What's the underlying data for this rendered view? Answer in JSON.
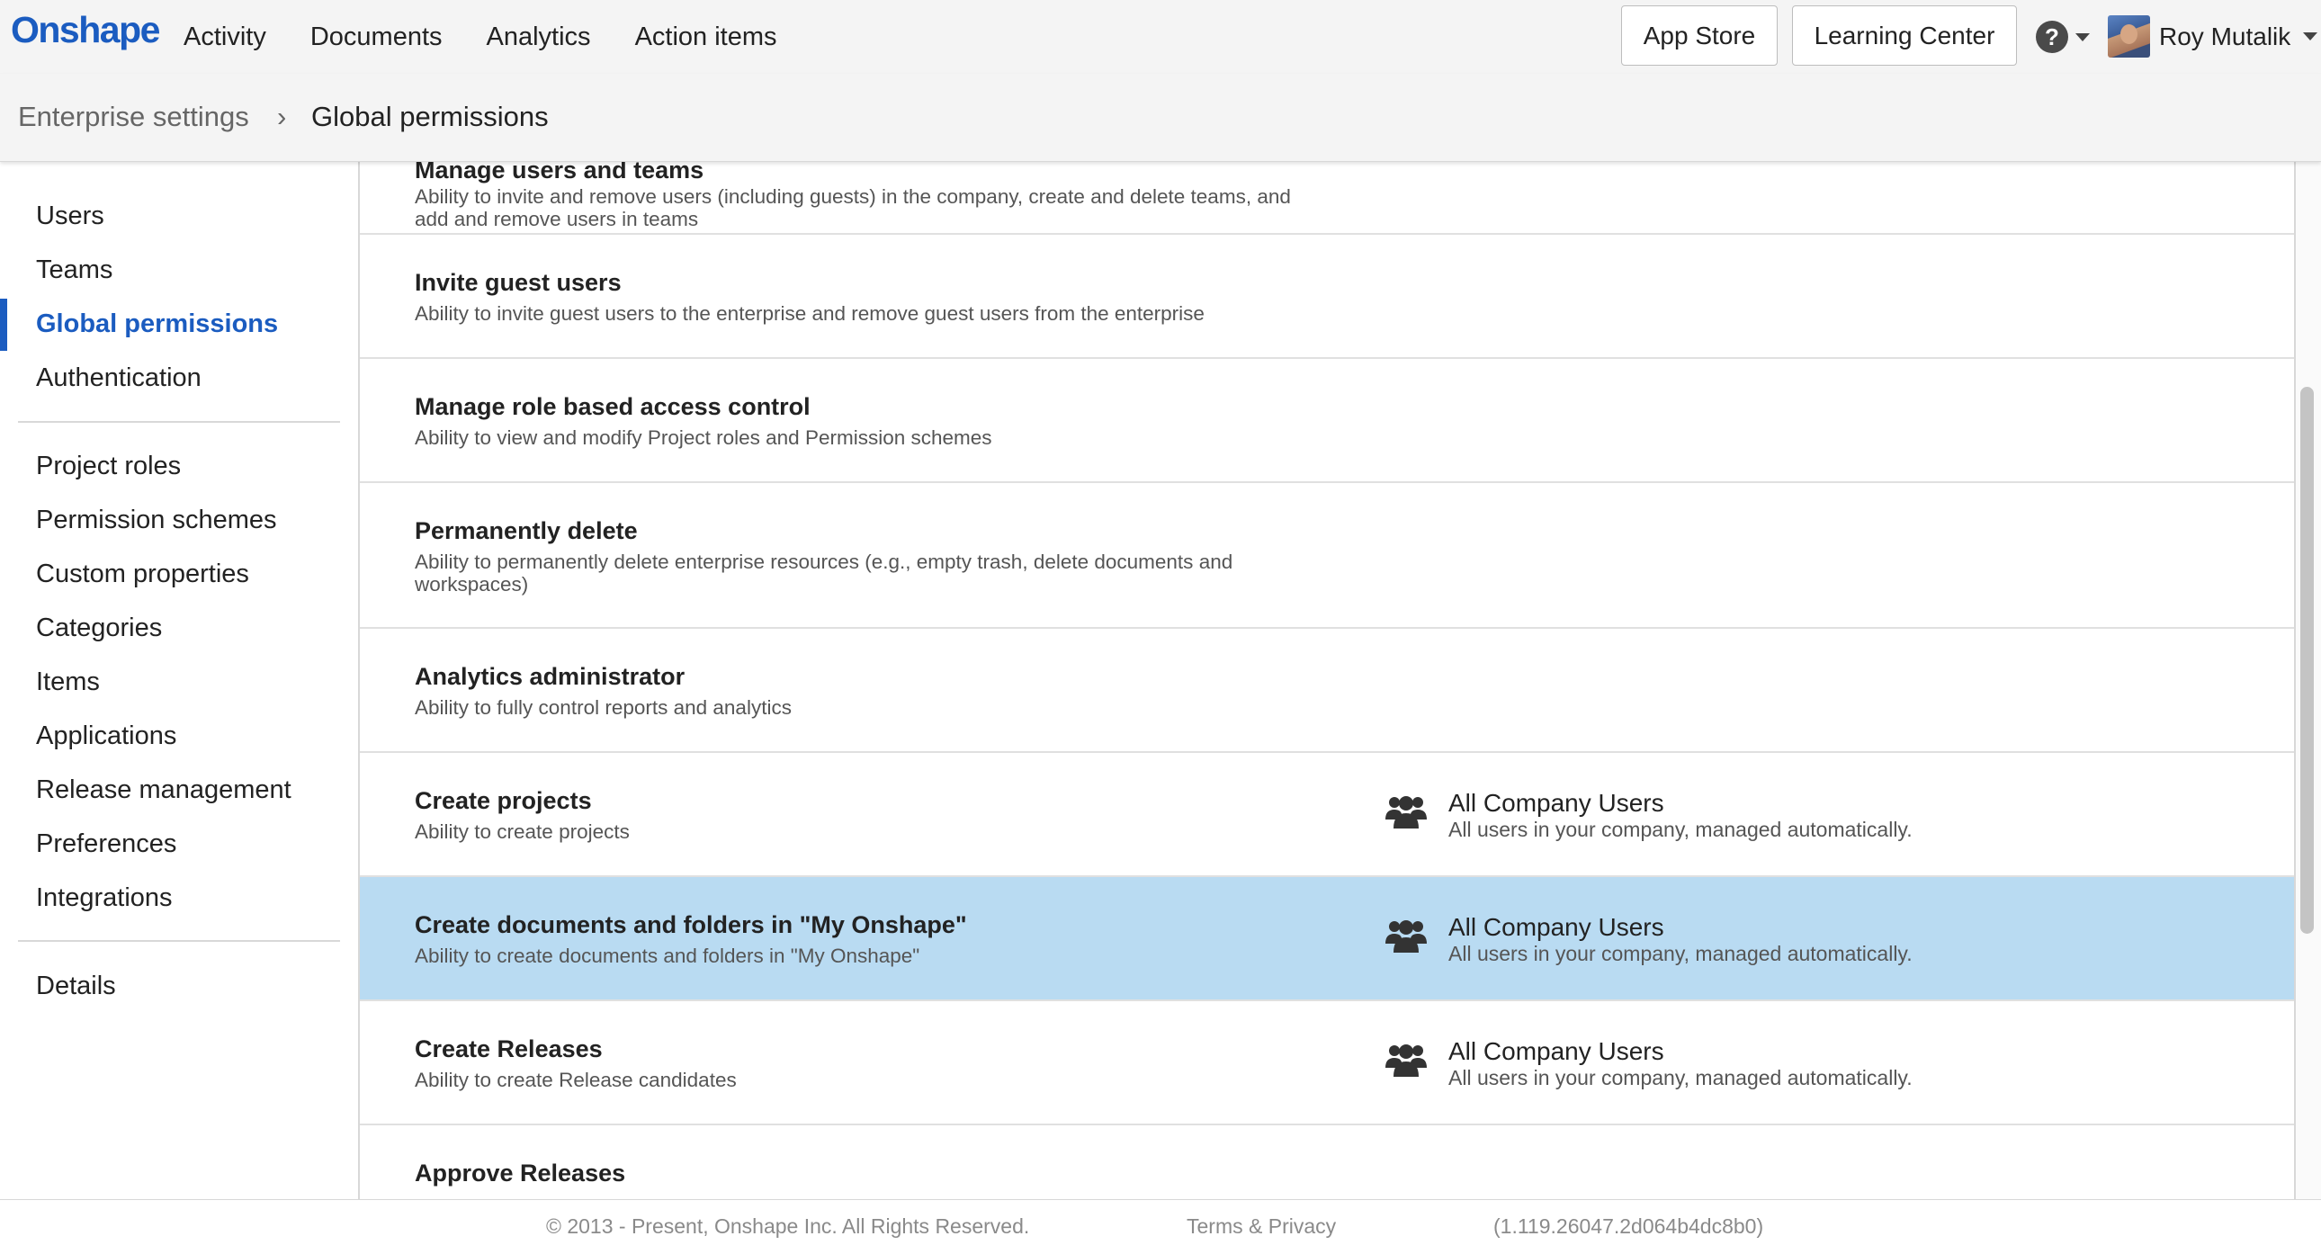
{
  "app": {
    "logo": "Onshape"
  },
  "nav": {
    "links": [
      "Activity",
      "Documents",
      "Analytics",
      "Action items"
    ],
    "app_store": "App Store",
    "learning_center": "Learning Center",
    "help_icon": "help-question-icon",
    "user_name": "Roy Mutalik"
  },
  "breadcrumb": {
    "root": "Enterprise settings",
    "separator": "›",
    "current": "Global permissions"
  },
  "sidebar": {
    "group1": [
      "Users",
      "Teams",
      "Global permissions",
      "Authentication"
    ],
    "group2": [
      "Project roles",
      "Permission schemes",
      "Custom properties",
      "Categories",
      "Items",
      "Applications",
      "Release management",
      "Preferences",
      "Integrations"
    ],
    "group3": [
      "Details"
    ],
    "active": "Global permissions"
  },
  "permissions": [
    {
      "title": "Manage users and teams",
      "description": "Ability to invite and remove users (including guests) in the company, create and delete teams, and add and remove users in teams"
    },
    {
      "title": "Invite guest users",
      "description": "Ability to invite guest users to the enterprise and remove guest users from the enterprise"
    },
    {
      "title": "Manage role based access control",
      "description": "Ability to view and modify Project roles and Permission schemes"
    },
    {
      "title": "Permanently delete",
      "description": "Ability to permanently delete enterprise resources (e.g., empty trash, delete documents and workspaces)"
    },
    {
      "title": "Analytics administrator",
      "description": "Ability to fully control reports and analytics"
    },
    {
      "title": "Create projects",
      "description": "Ability to create projects",
      "assignee": "All Company Users",
      "assignee_description": "All users in your company, managed automatically."
    },
    {
      "title": "Create documents and folders in \"My Onshape\"",
      "description": "Ability to create documents and folders in \"My Onshape\"",
      "assignee": "All Company Users",
      "assignee_description": "All users in your company, managed automatically.",
      "selected": true
    },
    {
      "title": "Create Releases",
      "description": "Ability to create Release candidates",
      "assignee": "All Company Users",
      "assignee_description": "All users in your company, managed automatically."
    },
    {
      "title": "Approve Releases",
      "description": ""
    }
  ],
  "footer": {
    "copyright": "© 2013 - Present, Onshape Inc. All Rights Reserved.",
    "terms": "Terms & Privacy",
    "version": "(1.119.26047.2d064b4dc8b0)"
  },
  "colors": {
    "brand": "#1b5cc0",
    "selected_row": "#b9dbf2",
    "top_bar": "#f4f4f4"
  }
}
